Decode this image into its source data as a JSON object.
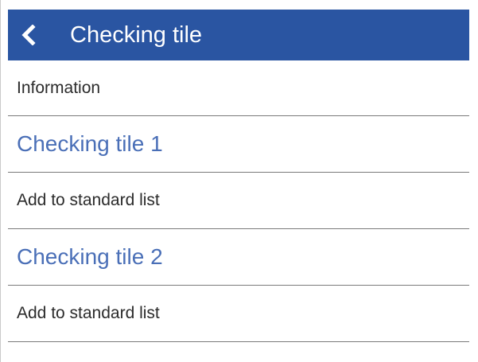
{
  "header": {
    "back_icon": "chevron-left-icon",
    "title": "Checking tile",
    "background_color": "#2a55a2"
  },
  "info_label": "Information",
  "tiles": [
    {
      "title": "Checking tile 1",
      "action_label": "Add to standard list"
    },
    {
      "title": "Checking tile 2",
      "action_label": "Add to standard list"
    }
  ],
  "colors": {
    "tile_title": "#4a6fb7",
    "body_text": "#2b2b2b",
    "divider": "#7a7a7a"
  }
}
